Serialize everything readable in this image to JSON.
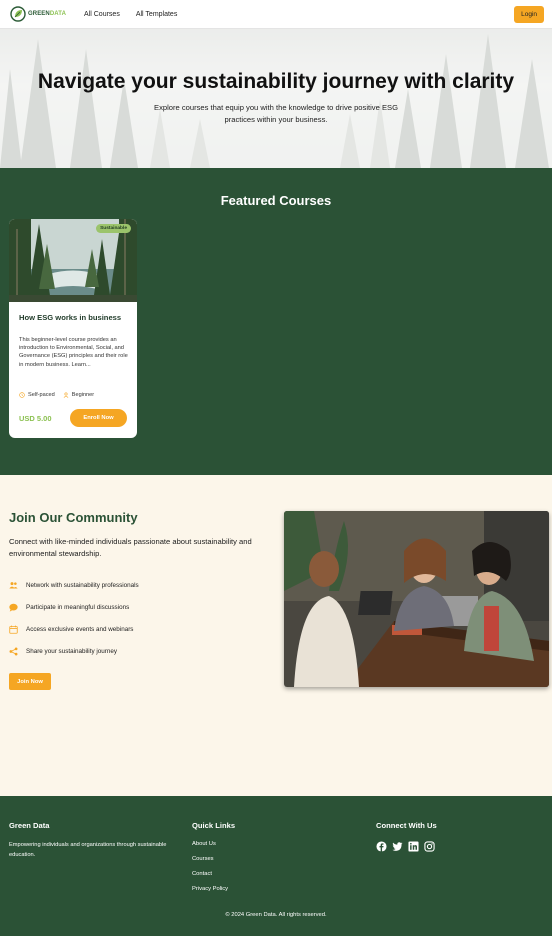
{
  "nav": {
    "logo_part1": "GREEN",
    "logo_part2": "DATA",
    "links": [
      "All Courses",
      "All Templates"
    ],
    "login_label": "Login"
  },
  "hero": {
    "title": "Navigate your sustainability journey with clarity",
    "subtitle": "Explore courses that equip you with the knowledge to drive positive ESG practices within your business."
  },
  "featured": {
    "title": "Featured Courses",
    "course": {
      "badge": "Sustainable",
      "title": "How ESG works in business",
      "description": "This beginner-level course provides an introduction to Environmental, Social, and Governance (ESG) principles and their role in modern business. Learn...",
      "pace": "Self-paced",
      "level": "Beginner",
      "price": "USD 5.00",
      "enroll_label": "Enroll Now"
    }
  },
  "community": {
    "title": "Join Our Community",
    "text": "Connect with like-minded individuals passionate about sustainability and environmental stewardship.",
    "benefits": [
      {
        "icon": "people-icon",
        "label": "Network with sustainability professionals"
      },
      {
        "icon": "chat-icon",
        "label": "Participate in meaningful discussions"
      },
      {
        "icon": "calendar-icon",
        "label": "Access exclusive events and webinars"
      },
      {
        "icon": "share-icon",
        "label": "Share your sustainability journey"
      }
    ],
    "join_label": "Join Now"
  },
  "footer": {
    "brand_title": "Green Data",
    "brand_text": "Empowering individuals and organizations through sustainable education.",
    "quick_links_title": "Quick Links",
    "quick_links": [
      "About Us",
      "Courses",
      "Contact",
      "Privacy Policy"
    ],
    "connect_title": "Connect With Us",
    "socials": [
      "facebook-icon",
      "twitter-icon",
      "linkedin-icon",
      "instagram-icon"
    ],
    "copyright": "© 2024 Green Data. All rights reserved."
  },
  "colors": {
    "primary_green": "#2b5236",
    "accent_orange": "#f5a623",
    "light_green": "#8cc152",
    "cream": "#fcf6ea"
  }
}
